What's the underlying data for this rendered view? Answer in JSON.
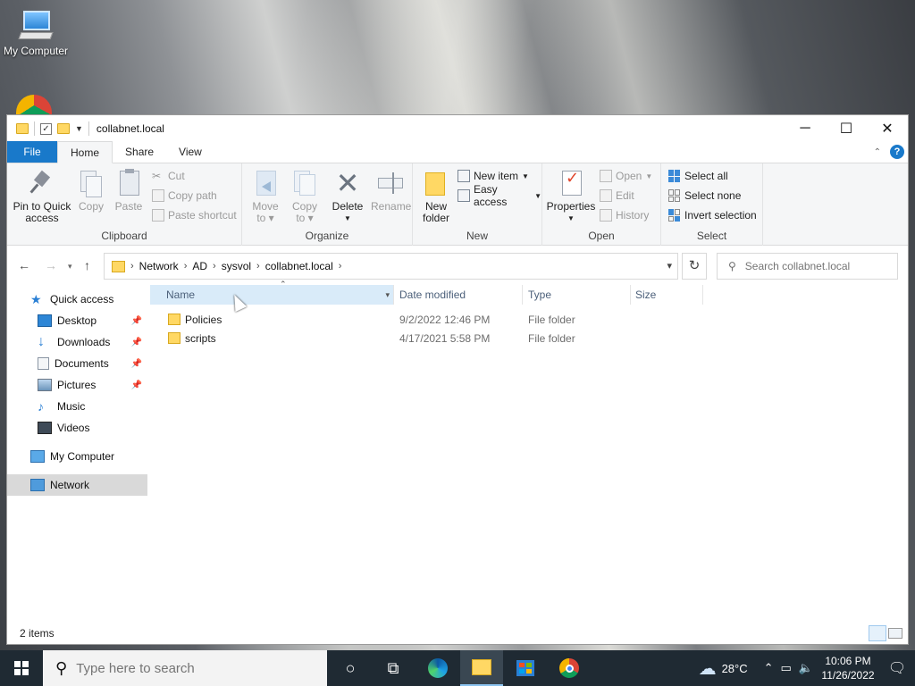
{
  "desktop": {
    "icon_label": "My Computer"
  },
  "window": {
    "title": "collabnet.local"
  },
  "tabs": {
    "file": "File",
    "home": "Home",
    "share": "Share",
    "view": "View"
  },
  "ribbon": {
    "clipboard": {
      "label": "Clipboard",
      "pin_quick_access_1": "Pin to Quick",
      "pin_quick_access_2": "access",
      "copy": "Copy",
      "paste": "Paste",
      "cut": "Cut",
      "copy_path": "Copy path",
      "paste_shortcut": "Paste shortcut"
    },
    "organize": {
      "label": "Organize",
      "move_to_1": "Move",
      "move_to_2": "to",
      "copy_to_1": "Copy",
      "copy_to_2": "to",
      "delete": "Delete",
      "rename": "Rename"
    },
    "new": {
      "label": "New",
      "new_folder_1": "New",
      "new_folder_2": "folder",
      "new_item": "New item",
      "easy_access": "Easy access"
    },
    "open": {
      "label": "Open",
      "properties": "Properties",
      "open": "Open",
      "edit": "Edit",
      "history": "History"
    },
    "select": {
      "label": "Select",
      "select_all": "Select all",
      "select_none": "Select none",
      "invert_selection": "Invert selection"
    }
  },
  "address": {
    "crumbs": [
      "Network",
      "AD",
      "sysvol",
      "collabnet.local"
    ],
    "search_placeholder": "Search collabnet.local"
  },
  "nav": {
    "quick_access": "Quick access",
    "items": [
      {
        "label": "Desktop",
        "icon": "desktop-icon",
        "pinned": true
      },
      {
        "label": "Downloads",
        "icon": "downloads-icon",
        "pinned": true
      },
      {
        "label": "Documents",
        "icon": "documents-icon",
        "pinned": true
      },
      {
        "label": "Pictures",
        "icon": "pictures-icon",
        "pinned": true
      },
      {
        "label": "Music",
        "icon": "music-icon",
        "pinned": false
      },
      {
        "label": "Videos",
        "icon": "videos-icon",
        "pinned": false
      }
    ],
    "my_computer": "My Computer",
    "network": "Network"
  },
  "list": {
    "columns": {
      "name": "Name",
      "date_modified": "Date modified",
      "type": "Type",
      "size": "Size"
    },
    "rows": [
      {
        "name": "Policies",
        "date": "9/2/2022 12:46 PM",
        "type": "File folder",
        "size": ""
      },
      {
        "name": "scripts",
        "date": "4/17/2021 5:58 PM",
        "type": "File folder",
        "size": ""
      }
    ]
  },
  "status": {
    "items": "2 items"
  },
  "taskbar": {
    "search_placeholder": "Type here to search",
    "temperature": "28°C",
    "time": "10:06 PM",
    "date": "11/26/2022"
  },
  "colors": {
    "accent": "#1979ca",
    "selection": "#d9ebf9",
    "taskbar": "#1f2a33"
  }
}
